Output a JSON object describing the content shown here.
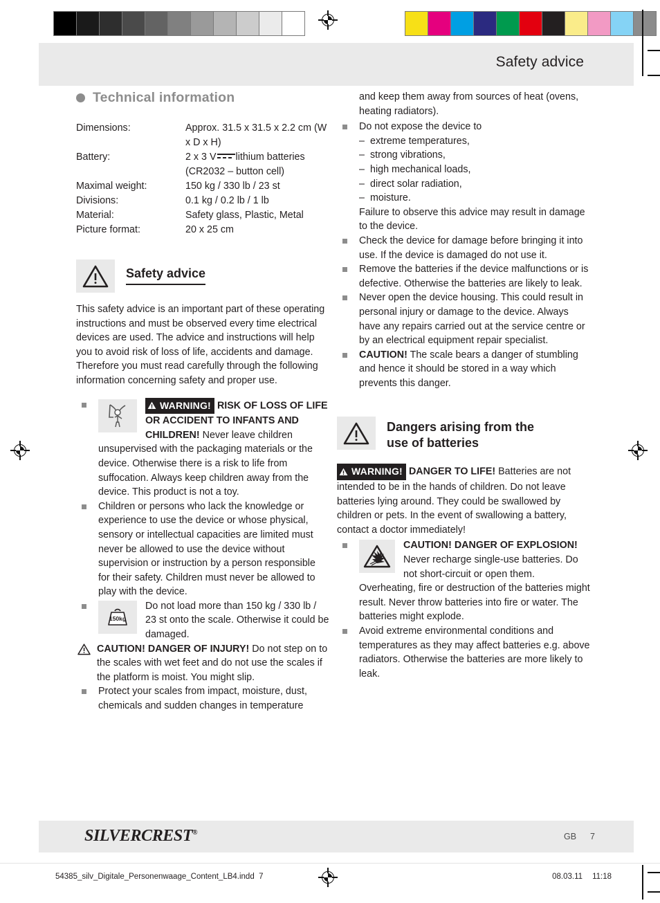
{
  "calibration": {
    "gray_swatches": [
      "#000000",
      "#1a1a1a",
      "#2e2e2e",
      "#4a4a4a",
      "#636363",
      "#808080",
      "#9a9a9a",
      "#b4b4b4",
      "#cccccc",
      "#ebebeb",
      "#ffffff"
    ],
    "color_swatches": [
      "#f7e017",
      "#e5007e",
      "#009fe3",
      "#2b2a80",
      "#009a4e",
      "#e3000f",
      "#231f20",
      "#faec8a",
      "#f29ac4",
      "#85d3f5",
      "#8c8c8c"
    ]
  },
  "header": {
    "title": "Safety advice"
  },
  "technical": {
    "heading": "Technical information",
    "rows": [
      {
        "label": "Dimensions:",
        "value": "Approx. 31.5 x 31.5 x 2.2 cm (W x D x H)"
      },
      {
        "label": "Battery:",
        "value_pre": "2 x 3 V",
        "value_post": "lithium batteries (CR2032 – button cell)"
      },
      {
        "label": "Maximal weight:",
        "value": "150 kg / 330 lb / 23 st"
      },
      {
        "label": "Divisions:",
        "value": "0.1 kg / 0.2 lb / 1 lb"
      },
      {
        "label": "Material:",
        "value": "Safety glass, Plastic, Metal"
      },
      {
        "label": "Picture format:",
        "value": "20 x 25 cm"
      }
    ]
  },
  "safety": {
    "heading": "Safety advice",
    "intro": "This safety advice is an important part of these operating instructions and must be observed every time electrical devices are used. The advice and instructions will help you to avoid risk of loss of life, accidents and damage. Therefore you must read carefully through the following information concerning safety and proper use."
  },
  "left_items": {
    "warning_badge": "WARNING!",
    "children_bold": "RISK OF LOSS OF LIFE OR ACCIDENT TO INFANTS AND CHILDREN!",
    "children_rest": " Never leave children unsupervised with the packaging materials or the device. Otherwise there is a risk to life from suffocation. Always keep children away from the device. This product is not a toy.",
    "knowledge": "Children or persons who lack the knowledge or experience to use the device or whose physical, sensory or intellectual capacities are limited must never be allowed to use the device without supervision or instruction by a person responsible for their safety. Children must never be allowed to play with the device.",
    "load_icon_label": "150kg",
    "load_text": "Do not load more than 150 kg / 330 lb / 23 st onto the scale. Otherwise it could be damaged.",
    "injury_bold": "CAUTION! DANGER OF INJURY!",
    "injury_rest": " Do not step on to the scales with wet feet and do not use the scales if the platform is moist. You might slip.",
    "protect": "Protect your scales from impact, moisture, dust, chemicals and sudden changes in temperature"
  },
  "right_items": {
    "continuation": "and keep them away from sources of heat (ovens, heating radiators).",
    "expose_lead": "Do not expose the device to",
    "expose_list": [
      "extreme temperatures,",
      "strong vibrations,",
      "high mechanical loads,",
      "direct solar radiation,",
      "moisture."
    ],
    "expose_tail": "Failure to observe this advice may result in damage to the device.",
    "check": "Check the device for damage before bringing it into use. If the device is damaged do not use it.",
    "remove": "Remove the batteries if the device malfunctions or is defective. Otherwise the batteries are likely to leak.",
    "never_open": "Never open the device housing. This could result in personal injury or damage to the device. Always have any repairs carried out at the service centre or by an electrical equipment repair specialist.",
    "stumble_bold": "CAUTION!",
    "stumble_rest": " The scale bears a danger of stumbling and hence it should be stored in a way which prevents this danger."
  },
  "batteries": {
    "heading_line1": "Dangers arising from the",
    "heading_line2": "use of batteries",
    "warning_badge": "WARNING!",
    "danger_bold": "DANGER TO LIFE!",
    "danger_rest": " Batteries are not intended to be in the hands of children. Do not leave batteries lying around. They could be swallowed by children or pets. In the event of swallowing a battery, contact a doctor immediately!",
    "explosion_bold": "CAUTION! DANGER OF EXPLOSION!",
    "explosion_rest": " Never recharge single-use batteries. Do not short-circuit or open them. Overheating, fire or destruction of the batteries might result. Never throw batteries into fire or water. The batteries might explode.",
    "avoid": "Avoid extreme environmental conditions and temperatures as they may affect batteries e.g. above radiators. Otherwise the batteries are more likely to leak."
  },
  "footer": {
    "logo_main": "SILVERCREST",
    "logo_mark": "®",
    "language": "GB",
    "page_number": "7"
  },
  "slug": {
    "file": "54385_silv_Digitale_Personenwaage_Content_LB4.indd",
    "file_page": "7",
    "date": "08.03.11",
    "time": "11:18"
  }
}
